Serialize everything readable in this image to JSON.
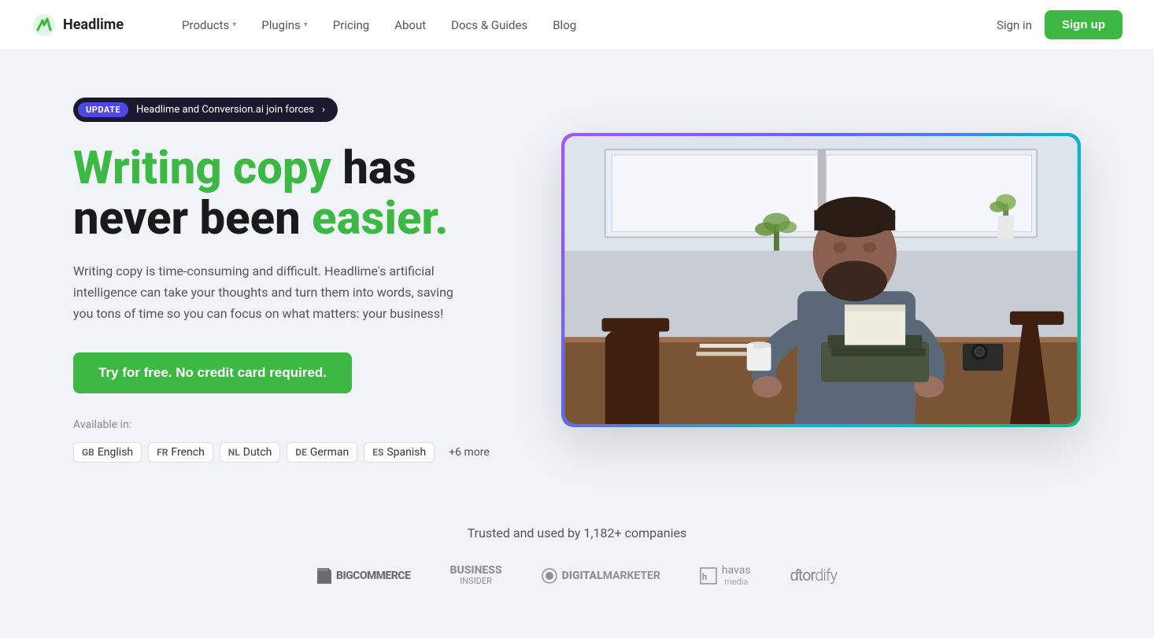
{
  "nav": {
    "logo_text": "Headlime",
    "links": [
      {
        "label": "Products",
        "has_dropdown": true
      },
      {
        "label": "Plugins",
        "has_dropdown": true
      },
      {
        "label": "Pricing",
        "has_dropdown": false
      },
      {
        "label": "About",
        "has_dropdown": false
      },
      {
        "label": "Docs & Guides",
        "has_dropdown": false
      },
      {
        "label": "Blog",
        "has_dropdown": false
      }
    ],
    "signin_label": "Sign in",
    "signup_label": "Sign up"
  },
  "hero": {
    "update_badge": "UPDATE",
    "update_text": "Headlime and Conversion.ai join forces",
    "update_arrow": "›",
    "headline_green1": "Writing copy",
    "headline_black1": " has",
    "headline_black2": "never been ",
    "headline_green2": "easier.",
    "subtext": "Writing copy is time-consuming and difficult. Headlime's artificial intelligence can take your thoughts and turn them into words, saving you tons of time so you can focus on what matters: your business!",
    "cta_label": "Try for free. No credit card required.",
    "available_in_label": "Available in:",
    "languages": [
      {
        "flag": "GB",
        "name": "English"
      },
      {
        "flag": "FR",
        "name": "French"
      },
      {
        "flag": "NL",
        "name": "Dutch"
      },
      {
        "flag": "DE",
        "name": "German"
      },
      {
        "flag": "ES",
        "name": "Spanish"
      }
    ],
    "more_label": "+6 more"
  },
  "trusted": {
    "title": "Trusted and used by 1,182+ companies",
    "logos": [
      {
        "name": "BigCommerce",
        "display": "BIGCOMMERCE"
      },
      {
        "name": "Business Insider",
        "display": "BUSINESS INSIDER"
      },
      {
        "name": "DigitalMarketer",
        "display": "DIGITALMARKETER"
      },
      {
        "name": "Havas Media",
        "display": "havas media"
      },
      {
        "name": "Chordify",
        "display": "chordify"
      }
    ]
  }
}
